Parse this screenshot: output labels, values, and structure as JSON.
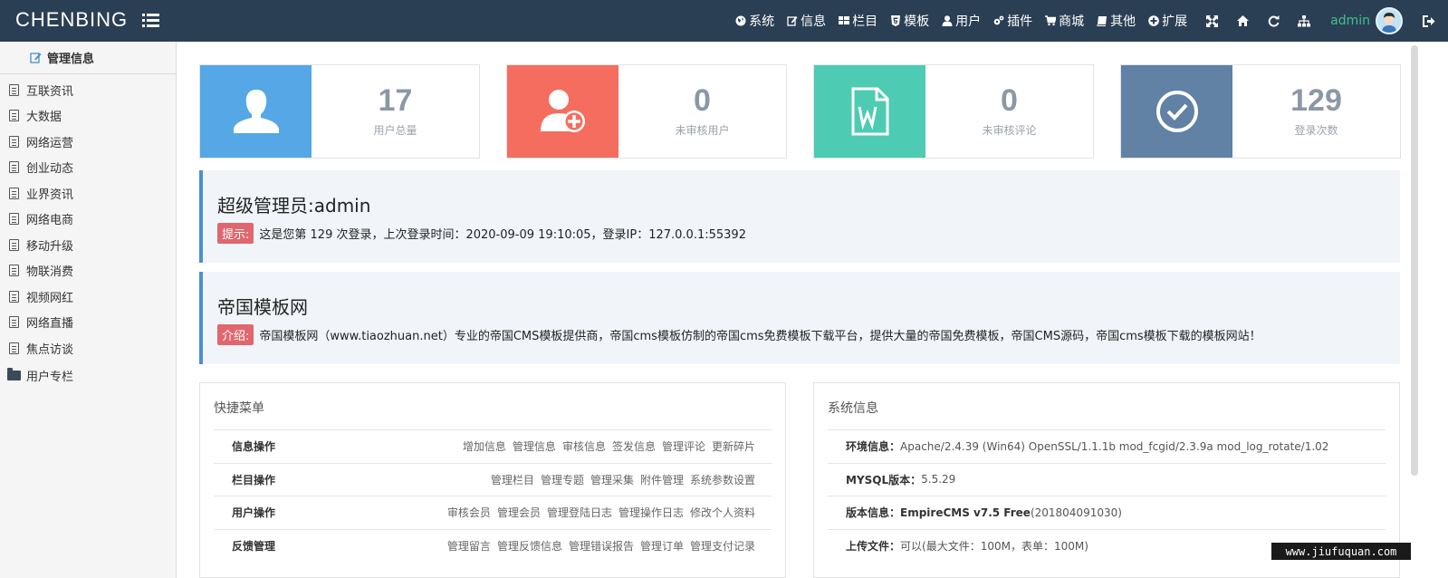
{
  "header": {
    "brand": "CHENBING",
    "nav": [
      {
        "label": "系统",
        "icon": "globe-icon"
      },
      {
        "label": "信息",
        "icon": "edit-icon"
      },
      {
        "label": "栏目",
        "icon": "grid-icon"
      },
      {
        "label": "模板",
        "icon": "html5-icon"
      },
      {
        "label": "用户",
        "icon": "user-icon"
      },
      {
        "label": "插件",
        "icon": "cogs-icon"
      },
      {
        "label": "商城",
        "icon": "cart-icon"
      },
      {
        "label": "其他",
        "icon": "book-icon"
      },
      {
        "label": "扩展",
        "icon": "plus-circle-icon"
      }
    ],
    "tools": [
      "fullscreen-icon",
      "home-icon",
      "refresh-icon",
      "sitemap-icon"
    ],
    "admin": "admin"
  },
  "sidebar": {
    "title": "管理信息",
    "items": [
      "互联资讯",
      "大数据",
      "网络运营",
      "创业动态",
      "业界资讯",
      "网络电商",
      "移动升级",
      "物联消费",
      "视频网红",
      "网络直播",
      "焦点访谈"
    ],
    "folder": "用户专栏"
  },
  "stats": [
    {
      "value": "17",
      "label": "用户总量",
      "color": "#55a7e6",
      "icon": "user-icon"
    },
    {
      "value": "0",
      "label": "未审核用户",
      "color": "#f56d5f",
      "icon": "user-add-icon"
    },
    {
      "value": "0",
      "label": "未审核评论",
      "color": "#4dcbb3",
      "icon": "word-doc-icon"
    },
    {
      "value": "129",
      "label": "登录次数",
      "color": "#6181a5",
      "icon": "check-circle-icon"
    }
  ],
  "welcome": {
    "title": "超级管理员:admin",
    "tag": "提示:",
    "text": "这是您第 129 次登录，上次登录时间：2020-09-09 19:10:05，登录IP：127.0.0.1:55392"
  },
  "intro": {
    "title": "帝国模板网",
    "tag": "介绍:",
    "text": "帝国模板网（www.tiaozhuan.net）专业的帝国CMS模板提供商，帝国cms模板仿制的帝国cms免费模板下载平台，提供大量的帝国免费模板，帝国CMS源码，帝国cms模板下载的模板网站！"
  },
  "quick_menu": {
    "title": "快捷菜单",
    "rows": [
      {
        "label": "信息操作",
        "links": [
          "增加信息",
          "管理信息",
          "审核信息",
          "签发信息",
          "管理评论",
          "更新碎片"
        ]
      },
      {
        "label": "栏目操作",
        "links": [
          "管理栏目",
          "管理专题",
          "管理采集",
          "附件管理",
          "系统参数设置"
        ]
      },
      {
        "label": "用户操作",
        "links": [
          "审核会员",
          "管理会员",
          "管理登陆日志",
          "管理操作日志",
          "修改个人资料"
        ]
      },
      {
        "label": "反馈管理",
        "links": [
          "管理留言",
          "管理反馈信息",
          "管理错误报告",
          "管理订单",
          "管理支付记录"
        ]
      }
    ]
  },
  "system_info": {
    "title": "系统信息",
    "rows": [
      {
        "label": "环境信息：",
        "value": "Apache/2.4.39 (Win64) OpenSSL/1.1.1b mod_fcgid/2.3.9a mod_log_rotate/1.02",
        "bold_value": ""
      },
      {
        "label": "MYSQL版本：",
        "value": "5.5.29",
        "bold_value": ""
      },
      {
        "label": "版本信息：",
        "value": " (201804091030)",
        "bold_value": "EmpireCMS v7.5 Free"
      },
      {
        "label": "上传文件：",
        "value": "可以(最大文件：100M，表单：100M)",
        "bold_value": ""
      }
    ]
  },
  "watermark": "www.jiufuquan.com"
}
